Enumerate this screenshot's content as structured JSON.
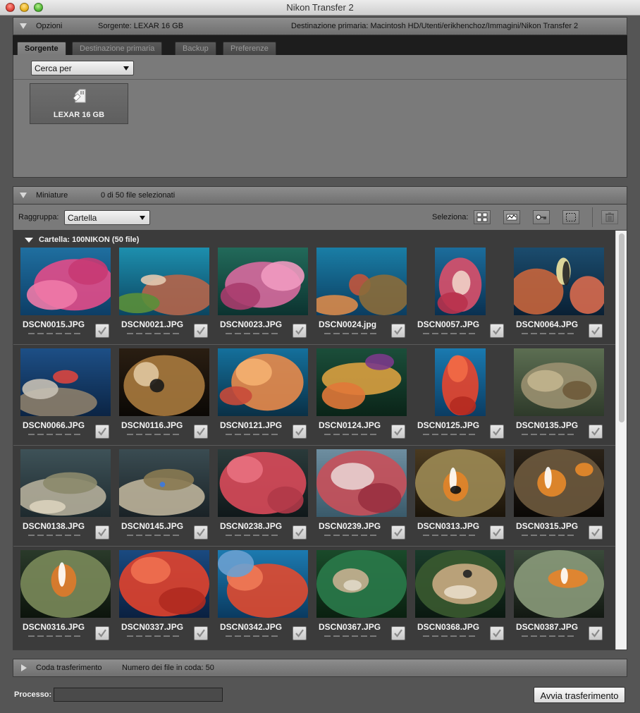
{
  "window": {
    "title": "Nikon Transfer 2"
  },
  "options": {
    "header_label": "Opzioni",
    "source_label": "Sorgente: LEXAR 16 GB",
    "destination_label": "Destinazione primaria:  Macintosh HD/Utenti/erikhenchoz/Immagini/Nikon Transfer 2",
    "tabs": [
      "Sorgente",
      "Destinazione primaria",
      "Backup",
      "Preferenze"
    ],
    "active_tab": "Sorgente",
    "search_select": "Cerca per",
    "device_name": "LEXAR 16 GB",
    "device_icon": "memory-card-icon"
  },
  "thumbnails": {
    "header_label": "Miniature",
    "selection_count": "0 di 50 file selezionati",
    "group_label": "Raggruppa:",
    "group_value": "Cartella",
    "select_label": "Seleziona:",
    "select_tools": [
      "select-all-icon",
      "select-wave-icon",
      "select-key-icon",
      "select-deselect-icon"
    ],
    "delete_tool": "trash-icon",
    "folder_label": "Cartella: 100NIKON (50 file)",
    "rows": [
      [
        {
          "name": "DSCN0015.JPG",
          "scene": "pink-coral-blue"
        },
        {
          "name": "DSCN0021.JPG",
          "scene": "fish-reef"
        },
        {
          "name": "DSCN0023.JPG",
          "scene": "pink-coral-dark"
        },
        {
          "name": "DSCN0024.jpg",
          "scene": "reef-grouper"
        },
        {
          "name": "DSCN0057.JPG",
          "scene": "spiky-coral-portrait"
        },
        {
          "name": "DSCN0064.JPG",
          "scene": "bannerfish"
        }
      ],
      [
        {
          "name": "DSCN0066.JPG",
          "scene": "hawkfish-reef"
        },
        {
          "name": "DSCN0116.JPG",
          "scene": "nudibranch-rock"
        },
        {
          "name": "DSCN0121.JPG",
          "scene": "orange-coral"
        },
        {
          "name": "DSCN0124.JPG",
          "scene": "yellow-coral-branch"
        },
        {
          "name": "DSCN0125.JPG",
          "scene": "red-coral-portrait"
        },
        {
          "name": "DSCN0135.JPG",
          "scene": "scorpionfish-sand"
        }
      ],
      [
        {
          "name": "DSCN0138.JPG",
          "scene": "stingray-sand"
        },
        {
          "name": "DSCN0145.JPG",
          "scene": "stingray-blue-spot"
        },
        {
          "name": "DSCN0238.JPG",
          "scene": "red-gorgonian"
        },
        {
          "name": "DSCN0239.JPG",
          "scene": "gorgonian-pattern"
        },
        {
          "name": "DSCN0313.JPG",
          "scene": "clownfish-anemone"
        },
        {
          "name": "DSCN0315.JPG",
          "scene": "clownfish-dark"
        }
      ],
      [
        {
          "name": "DSCN0316.JPG",
          "scene": "clownfish-green"
        },
        {
          "name": "DSCN0337.JPG",
          "scene": "red-soft-coral"
        },
        {
          "name": "DSCN0342.JPG",
          "scene": "red-coral-blue"
        },
        {
          "name": "DSCN0367.JPG",
          "scene": "pufferfish"
        },
        {
          "name": "DSCN0368.JPG",
          "scene": "pufferfish-close"
        },
        {
          "name": "DSCN0387.JPG",
          "scene": "clownfish-tentacles"
        }
      ]
    ]
  },
  "queue": {
    "header_label": "Coda trasferimento",
    "count_label": "Numero dei file in coda: 50"
  },
  "process": {
    "label": "Processo:",
    "progress": 0,
    "start_button": "Avvia trasferimento"
  },
  "colors": {
    "panel": "#7a7a7a",
    "grid_background": "#3b3b3b",
    "title_bar": "#dcdcdc"
  }
}
